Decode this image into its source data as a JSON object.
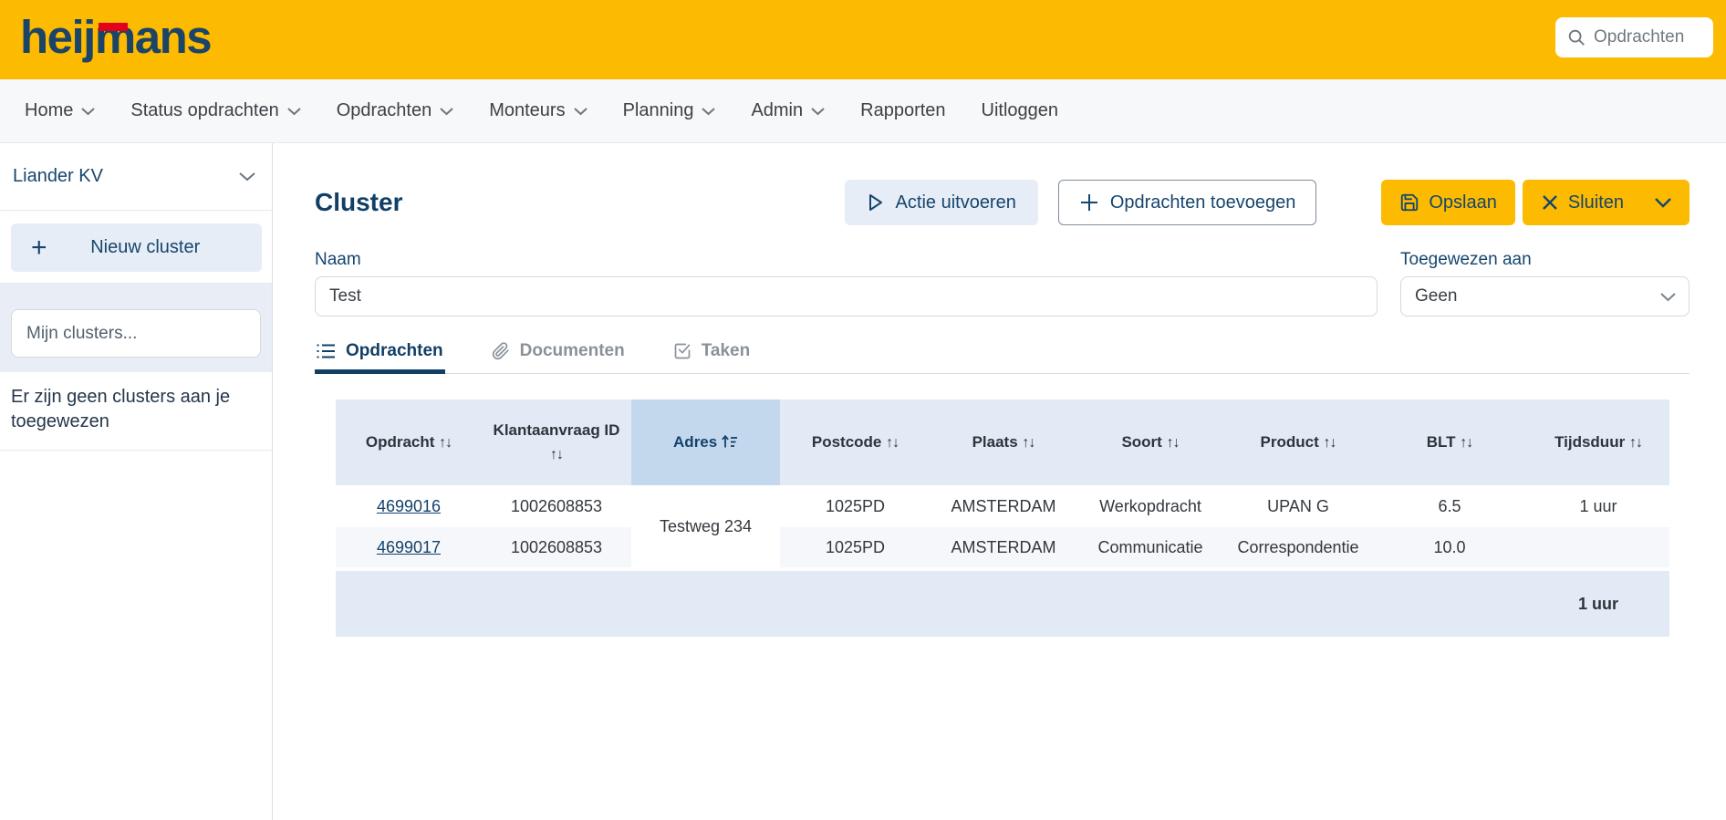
{
  "brand": {
    "logo_text": "heijmans",
    "colors": {
      "yellow": "#fcba00",
      "navy": "#16466e",
      "red_accent": "#e2001a",
      "table_header_bg": "#e2eaf6",
      "sorted_column_bg": "#c3d8ec",
      "row_alt_bg": "#f5f7fa"
    }
  },
  "topbar": {
    "search_placeholder": "Opdrachten"
  },
  "nav": {
    "items": [
      {
        "label": "Home",
        "dropdown": true
      },
      {
        "label": "Status opdrachten",
        "dropdown": true
      },
      {
        "label": "Opdrachten",
        "dropdown": true
      },
      {
        "label": "Monteurs",
        "dropdown": true
      },
      {
        "label": "Planning",
        "dropdown": true
      },
      {
        "label": "Admin",
        "dropdown": true
      },
      {
        "label": "Rapporten",
        "dropdown": false
      },
      {
        "label": "Uitloggen",
        "dropdown": false
      }
    ]
  },
  "sidebar": {
    "org_selector_value": "Liander KV",
    "new_cluster_button": "Nieuw cluster",
    "clusters_search_placeholder": "Mijn clusters...",
    "empty_message": "Er zijn geen clusters aan je toegewezen"
  },
  "main": {
    "title": "Cluster",
    "actions": {
      "execute": "Actie uitvoeren",
      "add_orders": "Opdrachten toevoegen",
      "save": "Opslaan",
      "close": "Sluiten"
    },
    "form": {
      "name_label": "Naam",
      "name_value": "Test",
      "assigned_label": "Toegewezen aan",
      "assigned_value": "Geen"
    },
    "tabs": [
      {
        "label": "Opdrachten",
        "active": true
      },
      {
        "label": "Documenten",
        "active": false
      },
      {
        "label": "Taken",
        "active": false
      }
    ],
    "table": {
      "columns": [
        {
          "label": "Opdracht",
          "sort": "unsorted"
        },
        {
          "label": "Klantaanvraag ID",
          "sort": "unsorted"
        },
        {
          "label": "Adres",
          "sort": "ascending"
        },
        {
          "label": "Postcode",
          "sort": "unsorted"
        },
        {
          "label": "Plaats",
          "sort": "unsorted"
        },
        {
          "label": "Soort",
          "sort": "unsorted"
        },
        {
          "label": "Product",
          "sort": "unsorted"
        },
        {
          "label": "BLT",
          "sort": "unsorted"
        },
        {
          "label": "Tijdsduur",
          "sort": "unsorted"
        }
      ],
      "rows": [
        {
          "opdracht": "4699016",
          "klantaanvraag_id": "1002608853",
          "adres": "Testweg 234",
          "postcode": "1025PD",
          "plaats": "AMSTERDAM",
          "soort": "Werkopdracht",
          "product": "UPAN G",
          "blt": "6.5",
          "tijdsduur": "1 uur"
        },
        {
          "opdracht": "4699017",
          "klantaanvraag_id": "1002608853",
          "postcode": "1025PD",
          "plaats": "AMSTERDAM",
          "soort": "Communicatie",
          "product": "Correspondentie",
          "blt": "10.0",
          "tijdsduur": ""
        }
      ],
      "footer": {
        "tijdsduur_total": "1 uur"
      }
    }
  }
}
